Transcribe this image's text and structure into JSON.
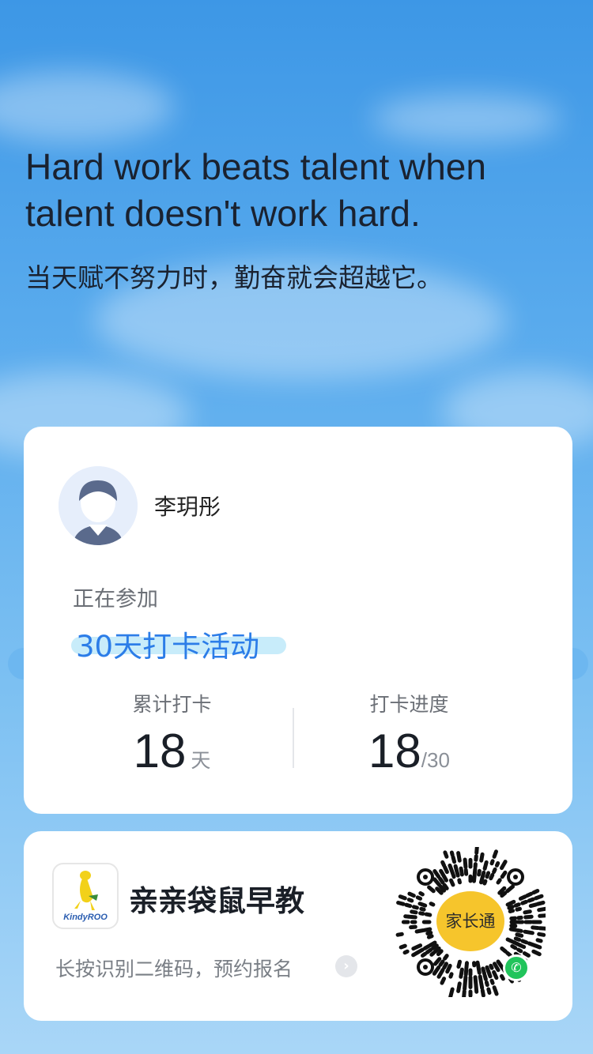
{
  "quote": {
    "english": "Hard work beats talent when talent doesn't work hard.",
    "chinese": "当天赋不努力时，勤奋就会超越它。"
  },
  "profile": {
    "name": "李玥彤",
    "avatar_icon": "boy-avatar-icon"
  },
  "activity": {
    "status_label": "正在参加",
    "title": "30天打卡活动"
  },
  "stats": {
    "cumulative": {
      "label": "累计打卡",
      "value": "18",
      "unit": "天"
    },
    "progress": {
      "label": "打卡进度",
      "value": "18",
      "total": "/30"
    }
  },
  "promo": {
    "logo_text": "KindyROO",
    "brand_name": "亲亲袋鼠早教",
    "hint": "长按识别二维码，预约报名",
    "qr_label": "家长通",
    "mini_program_icon": "wechat-mini-program-icon"
  },
  "colors": {
    "accent": "#2c7de8",
    "highlight": "#c8ecfa",
    "qr_badge": "#21c45b",
    "qr_center": "#f6c52c"
  }
}
